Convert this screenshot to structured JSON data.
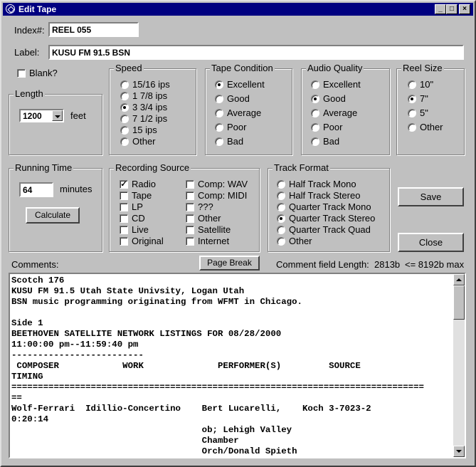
{
  "window": {
    "title": "Edit Tape"
  },
  "index": {
    "label": "Index#:",
    "value": "REEL 055"
  },
  "label_field": {
    "label": "Label:",
    "value": "KUSU FM 91.5 BSN"
  },
  "blank": {
    "label": "Blank?",
    "checked": false
  },
  "speed": {
    "title": "Speed",
    "options": [
      "15/16 ips",
      "1 7/8 ips",
      "3 3/4 ips",
      "7 1/2 ips",
      "15 ips",
      "Other"
    ],
    "selected": "3 3/4 ips"
  },
  "tape_condition": {
    "title": "Tape Condition",
    "options": [
      "Excellent",
      "Good",
      "Average",
      "Poor",
      "Bad"
    ],
    "selected": "Excellent"
  },
  "audio_quality": {
    "title": "Audio Quality",
    "options": [
      "Excellent",
      "Good",
      "Average",
      "Poor",
      "Bad"
    ],
    "selected": "Good"
  },
  "reel_size": {
    "title": "Reel Size",
    "options": [
      "10\"",
      "7\"",
      "5\"",
      "Other"
    ],
    "selected": "7\""
  },
  "length": {
    "title": "Length",
    "value": "1200",
    "unit": "feet"
  },
  "running_time": {
    "title": "Running Time",
    "value": "64",
    "unit": "minutes",
    "calculate_label": "Calculate"
  },
  "recording_source": {
    "title": "Recording Source",
    "col1": [
      {
        "label": "Radio",
        "checked": true
      },
      {
        "label": "Tape",
        "checked": false
      },
      {
        "label": "LP",
        "checked": false
      },
      {
        "label": "CD",
        "checked": false
      },
      {
        "label": "Live",
        "checked": false
      },
      {
        "label": "Original",
        "checked": false
      }
    ],
    "col2": [
      {
        "label": "Comp: WAV",
        "checked": false
      },
      {
        "label": "Comp: MIDI",
        "checked": false
      },
      {
        "label": "???",
        "checked": false
      },
      {
        "label": "Other",
        "checked": false
      },
      {
        "label": "Satellite",
        "checked": false
      },
      {
        "label": "Internet",
        "checked": false
      }
    ]
  },
  "track_format": {
    "title": "Track Format",
    "options": [
      "Half Track Mono",
      "Half Track Stereo",
      "Quarter Track Mono",
      "Quarter Track Stereo",
      "Quarter Track Quad",
      "Other"
    ],
    "selected": "Quarter Track Stereo"
  },
  "buttons": {
    "save": "Save",
    "close": "Close",
    "page_break": "Page Break"
  },
  "comments": {
    "label": "Comments:",
    "length_label": "Comment field Length:",
    "length_value": "2813b",
    "max_label": "<= 8192b max",
    "text": "Scotch 176\nKUSU FM 91.5 Utah State Univsity, Logan Utah\nBSN music programming originating from WFMT in Chicago.\n\nSide 1\nBEETHOVEN SATELLITE NETWORK LISTINGS FOR 08/28/2000\n11:00:00 pm--11:59:40 pm\n-------------------------\n COMPOSER            WORK              PERFORMER(S)         SOURCE\nTIMING\n==============================================================================\n==\nWolf-Ferrari  Idillio-Concertino    Bert Lucarelli,    Koch 3-7023-2\n0:20:14\n                                    ob; Lehigh Valley\n                                    Chamber\n                                    Orch/Donald Spieth"
  }
}
